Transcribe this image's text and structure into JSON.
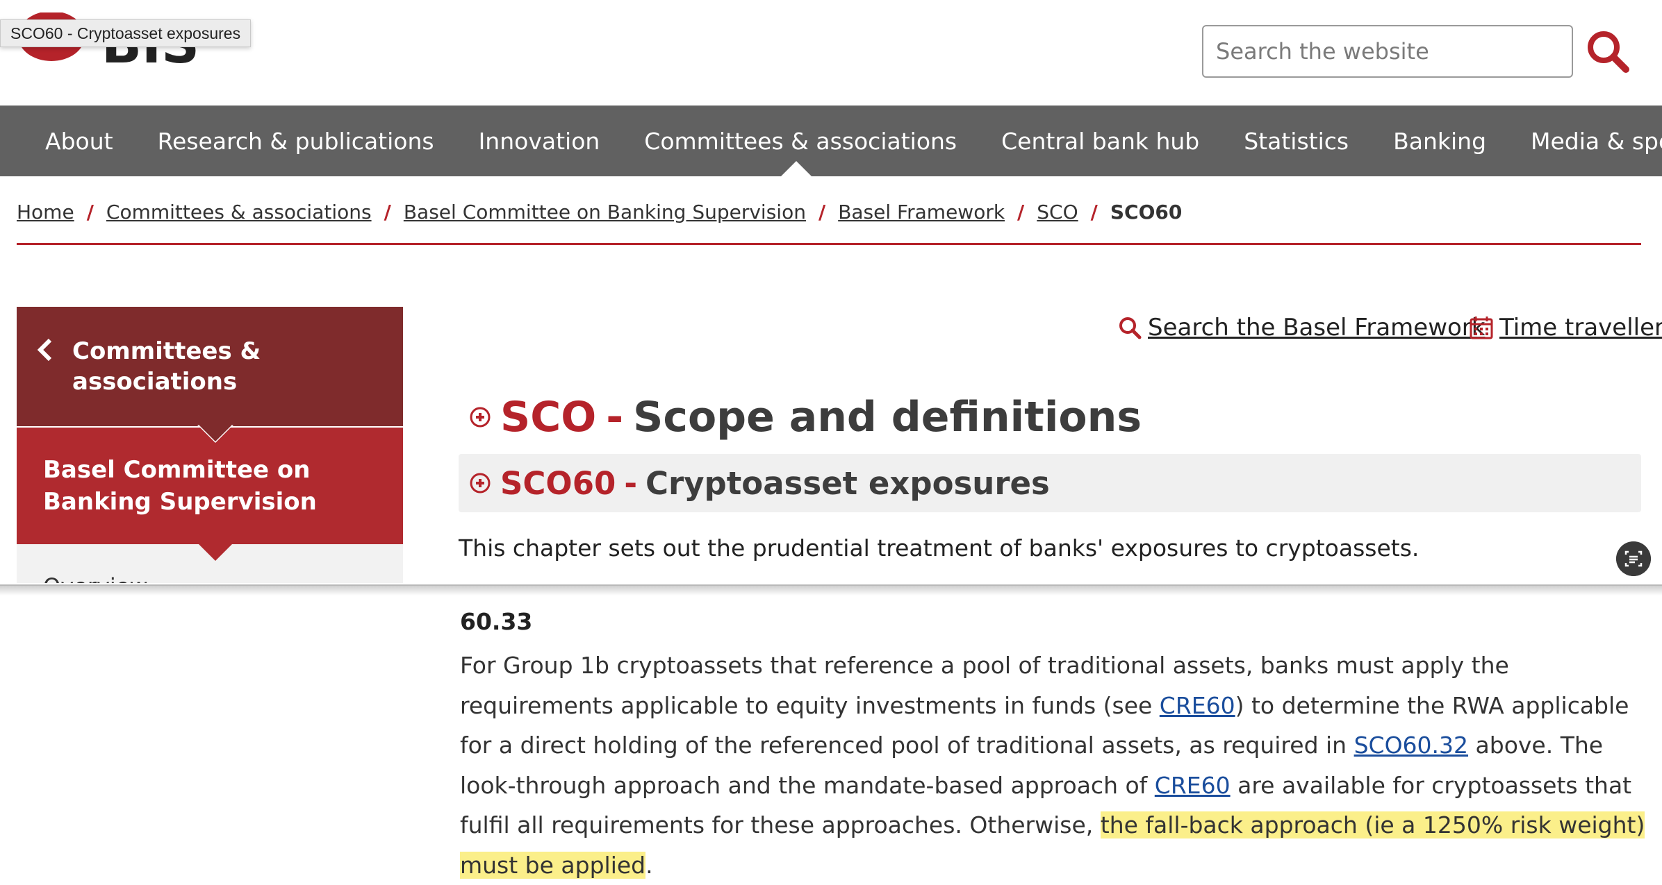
{
  "tooltip": "SCO60 - Cryptoasset exposures",
  "header": {
    "logo_text": "BIS",
    "search_placeholder": "Search the website"
  },
  "nav": {
    "items": [
      "About",
      "Research & publications",
      "Innovation",
      "Committees & associations",
      "Central bank hub",
      "Statistics",
      "Banking",
      "Media & speeches"
    ]
  },
  "breadcrumb": {
    "items": [
      "Home",
      "Committees & associations",
      "Basel Committee on Banking Supervision",
      "Basel Framework",
      "SCO"
    ],
    "current": "SCO60",
    "separator": "/"
  },
  "sidebar": {
    "parent": "Committees & associations",
    "current": "Basel Committee on Banking Supervision",
    "next_item": "Overview"
  },
  "tools": {
    "search_framework": "Search the Basel Framework",
    "time_traveller": "Time traveller"
  },
  "heading": {
    "code": "SCO",
    "dash": "-",
    "title": "Scope and definitions"
  },
  "subheading": {
    "code": "SCO60",
    "dash": "-",
    "title": "Cryptoasset exposures"
  },
  "intro": "This chapter sets out the prudential treatment of banks' exposures to cryptoassets.",
  "paragraph": {
    "number": "60.33",
    "part1": "For Group 1b cryptoassets that reference a pool of traditional assets, banks must apply the requirements applicable to equity investments in funds (see ",
    "link1": "CRE60",
    "part2": ") to determine the RWA applicable for a direct holding of the referenced pool of traditional assets, as required in ",
    "link2": "SCO60.32",
    "part3": " above. The look-through approach and the mandate-based approach of ",
    "link3": "CRE60",
    "part4": " are available for cryptoassets that fulfil all requirements for these approaches. Otherwise, ",
    "highlight": "the fall-back approach (ie a 1250% risk weight) must be applied",
    "part5": "."
  },
  "colors": {
    "brand_red": "#b5232a",
    "nav_grey": "#616161",
    "sidebar_dark": "#7f2b2c",
    "sidebar_red": "#b02a2f",
    "highlight": "#fbef8a",
    "link_blue": "#1a4d9c"
  },
  "icons": [
    "home-icon",
    "search-icon",
    "chevron-left-icon",
    "plus-circle-icon",
    "calendar-icon",
    "text-recognition-icon"
  ]
}
